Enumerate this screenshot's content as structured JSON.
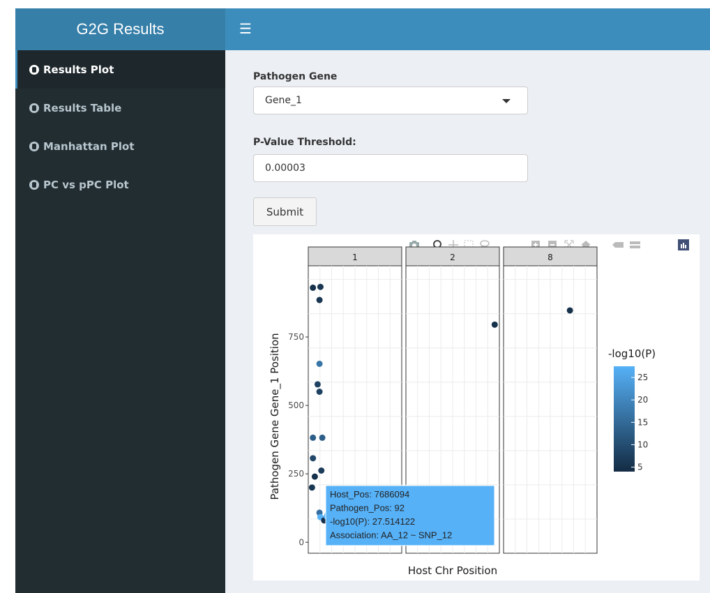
{
  "app": {
    "title": "G2G Results"
  },
  "topbar": {
    "menu_icon": "hamburger-icon"
  },
  "sidebar": {
    "items": [
      {
        "label": "Results Plot",
        "icon": "dashboard-icon",
        "active": true
      },
      {
        "label": "Results Table",
        "icon": "dashboard-icon",
        "active": false
      },
      {
        "label": "Manhattan Plot",
        "icon": "dashboard-icon",
        "active": false
      },
      {
        "label": "PC vs pPC Plot",
        "icon": "dashboard-icon",
        "active": false
      }
    ]
  },
  "form": {
    "gene_label": "Pathogen Gene",
    "gene_value": "Gene_1",
    "threshold_label": "P-Value Threshold:",
    "threshold_value": "0.00003",
    "submit_label": "Submit"
  },
  "modebar": {
    "icons": [
      "camera-icon",
      "zoom-icon",
      "pan-icon",
      "box-select-icon",
      "lasso-icon",
      "zoom-in-icon",
      "zoom-out-icon",
      "autoscale-icon",
      "reset-axes-icon",
      "hover-closest-icon",
      "hover-compare-icon",
      "plotly-logo-icon"
    ]
  },
  "tooltip": {
    "lines": [
      "Host_Pos:  7686094",
      "Pathogen_Pos:  92",
      "-log10(P): 27.514122",
      "Association: AA_12 ~ SNP_12"
    ]
  },
  "colors": {
    "low": "#132b43",
    "high": "#56b1f7",
    "header": "#3c8dbc",
    "logo": "#367fa9",
    "sidebar": "#222d32"
  },
  "chart_data": {
    "type": "scatter",
    "xlabel": "Host Chr Position",
    "ylabel": "Pathogen Gene Gene_1 Position",
    "ylim": [
      -40,
      1010
    ],
    "yticks": [
      0,
      250,
      500,
      750
    ],
    "facets": [
      "1",
      "2",
      "8"
    ],
    "color_legend": {
      "title": "-log10(P)",
      "ticks": [
        5,
        10,
        15,
        20,
        25
      ],
      "range": [
        4,
        27.5
      ]
    },
    "points": [
      {
        "facet": "1",
        "x": 0.05,
        "y": 930,
        "c": 5
      },
      {
        "facet": "1",
        "x": 0.13,
        "y": 933,
        "c": 6
      },
      {
        "facet": "1",
        "x": 0.12,
        "y": 885,
        "c": 6
      },
      {
        "facet": "1",
        "x": 0.12,
        "y": 652,
        "c": 17
      },
      {
        "facet": "1",
        "x": 0.1,
        "y": 577,
        "c": 8
      },
      {
        "facet": "1",
        "x": 0.12,
        "y": 550,
        "c": 8
      },
      {
        "facet": "1",
        "x": 0.05,
        "y": 382,
        "c": 13
      },
      {
        "facet": "1",
        "x": 0.15,
        "y": 382,
        "c": 13
      },
      {
        "facet": "1",
        "x": 0.05,
        "y": 307,
        "c": 9
      },
      {
        "facet": "1",
        "x": 0.14,
        "y": 262,
        "c": 7
      },
      {
        "facet": "1",
        "x": 0.07,
        "y": 240,
        "c": 5
      },
      {
        "facet": "1",
        "x": 0.04,
        "y": 200,
        "c": 6
      },
      {
        "facet": "1",
        "x": 0.12,
        "y": 108,
        "c": 16
      },
      {
        "facet": "1",
        "x": 0.13,
        "y": 92,
        "c": 27.514122
      },
      {
        "facet": "1",
        "x": 0.17,
        "y": 80,
        "c": 5
      },
      {
        "facet": "2",
        "x": 0.95,
        "y": 795,
        "c": 5
      },
      {
        "facet": "8",
        "x": 0.71,
        "y": 847,
        "c": 5
      }
    ]
  }
}
